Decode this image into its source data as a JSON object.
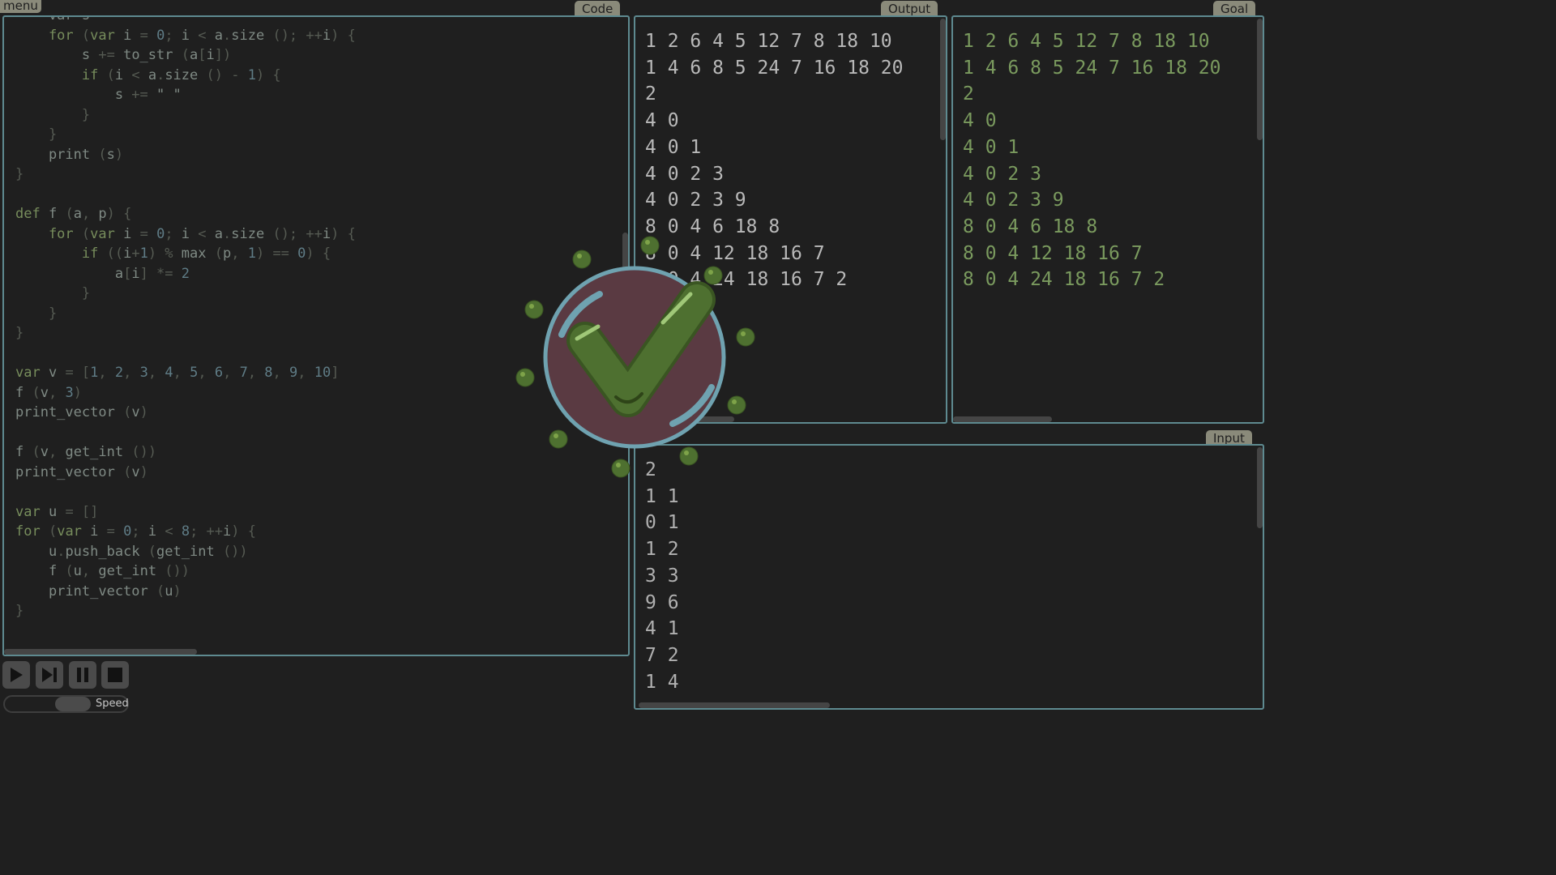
{
  "menu_label": "menu",
  "tabs": {
    "code": "Code",
    "output": "Output",
    "goal": "Goal",
    "input": "Input"
  },
  "code_lines": [
    [
      [
        "id",
        "    var s = "
      ],
      [
        "",
        "\"\""
      ]
    ],
    [
      [
        "kw",
        "    for "
      ],
      [
        "",
        "("
      ],
      [
        "kw",
        "var "
      ],
      [
        "id",
        "i "
      ],
      [
        "",
        "= "
      ],
      [
        "nm",
        "0"
      ],
      [
        "",
        "; "
      ],
      [
        "id",
        "i "
      ],
      [
        "",
        "< "
      ],
      [
        "id",
        "a"
      ],
      [
        "",
        "."
      ],
      [
        "id",
        "size "
      ],
      [
        "",
        "(); ++"
      ],
      [
        "id",
        "i"
      ],
      [
        "",
        ") {"
      ]
    ],
    [
      [
        "id",
        "        s "
      ],
      [
        "",
        "+= "
      ],
      [
        "id",
        "to_str "
      ],
      [
        "",
        "("
      ],
      [
        "id",
        "a"
      ],
      [
        "",
        "["
      ],
      [
        "id",
        "i"
      ],
      [
        "",
        "])"
      ]
    ],
    [
      [
        "kw",
        "        if "
      ],
      [
        "",
        "("
      ],
      [
        "id",
        "i "
      ],
      [
        "",
        "< "
      ],
      [
        "id",
        "a"
      ],
      [
        "",
        "."
      ],
      [
        "id",
        "size "
      ],
      [
        "",
        "() - "
      ],
      [
        "nm",
        "1"
      ],
      [
        "",
        ") {"
      ]
    ],
    [
      [
        "id",
        "            s "
      ],
      [
        "",
        "+= "
      ],
      [
        "id",
        "\" \""
      ]
    ],
    [
      [
        "",
        "        }"
      ]
    ],
    [
      [
        "",
        "    }"
      ]
    ],
    [
      [
        "id",
        "    print "
      ],
      [
        "",
        "("
      ],
      [
        "id",
        "s"
      ],
      [
        "",
        ")"
      ]
    ],
    [
      [
        "",
        "}"
      ]
    ],
    [
      [
        "",
        ""
      ]
    ],
    [
      [
        "kw",
        "def "
      ],
      [
        "id",
        "f "
      ],
      [
        "",
        "("
      ],
      [
        "id",
        "a"
      ],
      [
        "",
        ", "
      ],
      [
        "id",
        "p"
      ],
      [
        "",
        ") {"
      ]
    ],
    [
      [
        "kw",
        "    for "
      ],
      [
        "",
        "("
      ],
      [
        "kw",
        "var "
      ],
      [
        "id",
        "i "
      ],
      [
        "",
        "= "
      ],
      [
        "nm",
        "0"
      ],
      [
        "",
        "; "
      ],
      [
        "id",
        "i "
      ],
      [
        "",
        "< "
      ],
      [
        "id",
        "a"
      ],
      [
        "",
        "."
      ],
      [
        "id",
        "size "
      ],
      [
        "",
        "(); ++"
      ],
      [
        "id",
        "i"
      ],
      [
        "",
        ") {"
      ]
    ],
    [
      [
        "kw",
        "        if "
      ],
      [
        "",
        "(("
      ],
      [
        "id",
        "i"
      ],
      [
        "",
        "+"
      ],
      [
        "nm",
        "1"
      ],
      [
        "",
        ") % "
      ],
      [
        "id",
        "max "
      ],
      [
        "",
        "("
      ],
      [
        "id",
        "p"
      ],
      [
        "",
        ", "
      ],
      [
        "nm",
        "1"
      ],
      [
        "",
        ") == "
      ],
      [
        "nm",
        "0"
      ],
      [
        "",
        ") {"
      ]
    ],
    [
      [
        "id",
        "            a"
      ],
      [
        "",
        "["
      ],
      [
        "id",
        "i"
      ],
      [
        "",
        "] *= "
      ],
      [
        "nm",
        "2"
      ]
    ],
    [
      [
        "",
        "        }"
      ]
    ],
    [
      [
        "",
        "    }"
      ]
    ],
    [
      [
        "",
        "}"
      ]
    ],
    [
      [
        "",
        ""
      ]
    ],
    [
      [
        "kw",
        "var "
      ],
      [
        "id",
        "v "
      ],
      [
        "",
        "= ["
      ],
      [
        "nm",
        "1"
      ],
      [
        "",
        ", "
      ],
      [
        "nm",
        "2"
      ],
      [
        "",
        ", "
      ],
      [
        "nm",
        "3"
      ],
      [
        "",
        ", "
      ],
      [
        "nm",
        "4"
      ],
      [
        "",
        ", "
      ],
      [
        "nm",
        "5"
      ],
      [
        "",
        ", "
      ],
      [
        "nm",
        "6"
      ],
      [
        "",
        ", "
      ],
      [
        "nm",
        "7"
      ],
      [
        "",
        ", "
      ],
      [
        "nm",
        "8"
      ],
      [
        "",
        ", "
      ],
      [
        "nm",
        "9"
      ],
      [
        "",
        ", "
      ],
      [
        "nm",
        "10"
      ],
      [
        "",
        "]"
      ]
    ],
    [
      [
        "id",
        "f "
      ],
      [
        "",
        "("
      ],
      [
        "id",
        "v"
      ],
      [
        "",
        ", "
      ],
      [
        "nm",
        "3"
      ],
      [
        "",
        ")"
      ]
    ],
    [
      [
        "id",
        "print_vector "
      ],
      [
        "",
        "("
      ],
      [
        "id",
        "v"
      ],
      [
        "",
        ")"
      ]
    ],
    [
      [
        "",
        ""
      ]
    ],
    [
      [
        "id",
        "f "
      ],
      [
        "",
        "("
      ],
      [
        "id",
        "v"
      ],
      [
        "",
        ", "
      ],
      [
        "id",
        "get_int "
      ],
      [
        "",
        "())"
      ]
    ],
    [
      [
        "id",
        "print_vector "
      ],
      [
        "",
        "("
      ],
      [
        "id",
        "v"
      ],
      [
        "",
        ")"
      ]
    ],
    [
      [
        "",
        ""
      ]
    ],
    [
      [
        "kw",
        "var "
      ],
      [
        "id",
        "u "
      ],
      [
        "",
        "= []"
      ]
    ],
    [
      [
        "kw",
        "for "
      ],
      [
        "",
        "("
      ],
      [
        "kw",
        "var "
      ],
      [
        "id",
        "i "
      ],
      [
        "",
        "= "
      ],
      [
        "nm",
        "0"
      ],
      [
        "",
        "; "
      ],
      [
        "id",
        "i "
      ],
      [
        "",
        "< "
      ],
      [
        "nm",
        "8"
      ],
      [
        "",
        "; ++"
      ],
      [
        "id",
        "i"
      ],
      [
        "",
        ") {"
      ]
    ],
    [
      [
        "id",
        "    u"
      ],
      [
        "",
        "."
      ],
      [
        "id",
        "push_back "
      ],
      [
        "",
        "("
      ],
      [
        "id",
        "get_int "
      ],
      [
        "",
        "())"
      ]
    ],
    [
      [
        "id",
        "    f "
      ],
      [
        "",
        "("
      ],
      [
        "id",
        "u"
      ],
      [
        "",
        ", "
      ],
      [
        "id",
        "get_int "
      ],
      [
        "",
        "())"
      ]
    ],
    [
      [
        "id",
        "    print_vector "
      ],
      [
        "",
        "("
      ],
      [
        "id",
        "u"
      ],
      [
        "",
        ")"
      ]
    ],
    [
      [
        "",
        "}"
      ]
    ]
  ],
  "output_lines": [
    "1 2 6 4 5 12 7 8 18 10",
    "1 4 6 8 5 24 7 16 18 20",
    "2",
    "4 0",
    "4 0 1",
    "4 0 2 3",
    "4 0 2 3 9",
    "8 0 4 6 18 8",
    "8 0 4 12 18 16 7",
    "8 0 4 24 18 16 7 2"
  ],
  "goal_lines": [
    "1 2 6 4 5 12 7 8 18 10",
    "1 4 6 8 5 24 7 16 18 20",
    "2",
    "4 0",
    "4 0 1",
    "4 0 2 3",
    "4 0 2 3 9",
    "8 0 4 6 18 8",
    "8 0 4 12 18 16 7",
    "8 0 4 24 18 16 7 2"
  ],
  "input_lines": [
    "2",
    "1 1",
    "0 1",
    "1 2",
    "3 3",
    "9 6",
    "4 1",
    "7 2",
    "1 4"
  ],
  "controls": {
    "play_icon": "play-icon",
    "step_icon": "step-forward-icon",
    "pause_icon": "pause-icon",
    "stop_icon": "stop-icon"
  },
  "speed_label": "Speed",
  "speed_level": 0.55,
  "success_icon": "checkmark-success-icon",
  "colors": {
    "background": "#1f1f1f",
    "panel_border": "#5e8a90",
    "tab_bg": "#8a8a7a",
    "goal_text": "#7a9a5e",
    "check_green": "#4e7030",
    "check_circle": "#5a3a42"
  }
}
